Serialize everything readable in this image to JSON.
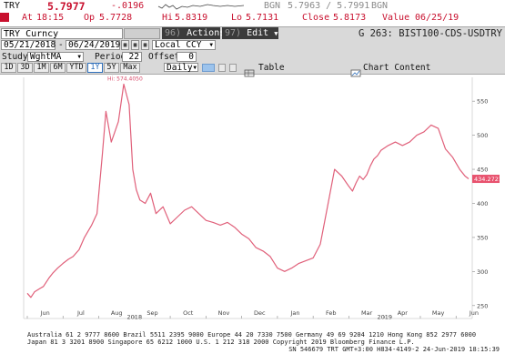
{
  "quote": {
    "ticker": "TRY",
    "last": "5.7977",
    "change": "-.0196",
    "bgn1_label": "BGN",
    "bid_ask": "5.7963 / 5.7991",
    "bgn2_label": "BGN",
    "at_label": "At",
    "time": "18:15",
    "op_label": "Op",
    "open": "5.7728",
    "hi_label": "Hi",
    "high": "5.8319",
    "lo_label": "Lo",
    "low": "5.7131",
    "close_label": "Close",
    "close": "5.8173",
    "value_label": "Value",
    "value_date": "06/25/19"
  },
  "toolbar": {
    "security": "TRY Curncy",
    "actions_num": "96)",
    "actions_label": "Actions",
    "edit_num": "97)",
    "edit_label": "Edit",
    "graph_title": "G 263: BIST100-CDS-USDTRY",
    "start_date": "05/21/2018",
    "end_date": "06/24/2019",
    "currency": "Local CCY",
    "study_label": "Study",
    "study_value": "WghtMA",
    "period_label": "Period",
    "period_value": "22",
    "offset_label": "Offset",
    "offset_value": "0",
    "ranges": [
      "1D",
      "3D",
      "1M",
      "6M",
      "YTD",
      "1Y",
      "5Y",
      "Max"
    ],
    "selected_range": "1Y",
    "frequency": "Daily",
    "table_label": "Table",
    "chart_content_label": "Chart Content"
  },
  "colors": {
    "line": "#e0607a",
    "badge": "#e8526e",
    "label": "#d94b6a",
    "accent": "#2f6fba"
  },
  "chart_data": {
    "type": "line",
    "title": "",
    "xlabel": "",
    "ylabel": "",
    "grid": false,
    "ylim": [
      231,
      585
    ],
    "y_ticks": [
      "250",
      "300",
      "350",
      "400",
      "450",
      "500",
      "550"
    ],
    "x_ticks": [
      "Jun",
      "Jul",
      "Aug",
      "Sep",
      "Oct",
      "Nov",
      "Dec",
      "Jan",
      "Feb",
      "Mar",
      "Apr",
      "May",
      "Jun"
    ],
    "year_labels": [
      {
        "text": "2018",
        "month_index": 3
      },
      {
        "text": "2019",
        "month_index": 10
      }
    ],
    "max_label": "Hi: 574.4050",
    "last_value_label": "434.2721",
    "series": [
      {
        "name": "",
        "x_month": [
          0.0,
          0.1,
          0.2,
          0.35,
          0.45,
          0.6,
          0.72,
          0.85,
          1.0,
          1.15,
          1.28,
          1.45,
          1.6,
          1.8,
          1.95,
          2.1,
          2.2,
          2.35,
          2.45,
          2.55,
          2.7,
          2.85,
          2.95,
          3.05,
          3.15,
          3.3,
          3.45,
          3.6,
          3.8,
          4.0,
          4.2,
          4.4,
          4.6,
          4.8,
          5.0,
          5.2,
          5.4,
          5.6,
          5.8,
          6.0,
          6.2,
          6.4,
          6.6,
          6.8,
          7.0,
          7.2,
          7.4,
          7.6,
          7.8,
          8.0,
          8.2,
          8.4,
          8.6,
          8.8,
          9.0,
          9.1,
          9.2,
          9.3,
          9.4,
          9.5,
          9.6,
          9.7,
          9.8,
          9.9,
          10.1,
          10.3,
          10.5,
          10.7,
          10.9,
          11.1,
          11.3,
          11.5,
          11.7,
          11.9,
          12.1,
          12.25,
          12.35
        ],
        "values": [
          268,
          262,
          270,
          275,
          278,
          290,
          298,
          305,
          312,
          318,
          322,
          332,
          350,
          368,
          385,
          472,
          535,
          490,
          505,
          520,
          575,
          545,
          450,
          420,
          405,
          400,
          415,
          385,
          395,
          370,
          380,
          390,
          395,
          385,
          375,
          372,
          368,
          372,
          365,
          355,
          348,
          335,
          330,
          322,
          305,
          300,
          305,
          312,
          316,
          320,
          340,
          395,
          450,
          440,
          425,
          418,
          430,
          440,
          435,
          442,
          455,
          465,
          470,
          478,
          485,
          490,
          485,
          490,
          500,
          505,
          515,
          510,
          480,
          468,
          450,
          440,
          436
        ]
      }
    ]
  },
  "footer": {
    "line1": "Australia 61 2 9777 8600  Brazil 5511 2395 9000  Europe 44 20 7330 7500  Germany 49 69 9204 1210  Hong Kong 852 2977 6000",
    "line2": "Japan 81 3 3201 8900          Singapore 65 6212 1000          U.S. 1 212 318 2000          Copyright 2019 Bloomberg Finance L.P.",
    "line3": "SN 546679 TRT  GMT+3:00 H834-4149-2 24-Jun-2019 18:15:39"
  }
}
